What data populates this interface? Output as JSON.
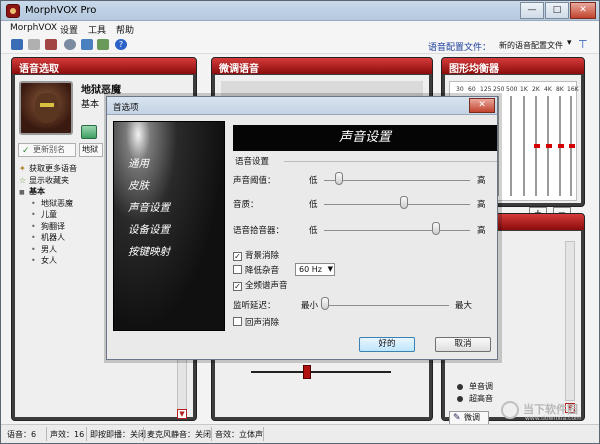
{
  "window": {
    "title": "MorphVOX Pro",
    "min": "—",
    "max": "□",
    "close": "✕"
  },
  "menu": [
    "MorphVOX",
    "设置",
    "工具",
    "帮助"
  ],
  "toolbar": {
    "preset_label": "语音配置文件：",
    "preset_value": "新的语音配置文件"
  },
  "panels": {
    "voice_select": {
      "title": "语音选取",
      "voice_name": "地狱恶魔",
      "voice_category": "基本",
      "update_label": "更新别名",
      "more_label": "地狱",
      "tree": [
        {
          "label": "获取更多语音",
          "level": 0,
          "marker": "✦"
        },
        {
          "label": "显示收藏夹",
          "level": 0,
          "marker": "☆"
        },
        {
          "label": "基本",
          "level": 0,
          "marker": "■"
        },
        {
          "label": "地狱恶魔",
          "level": 1,
          "marker": "•"
        },
        {
          "label": "儿童",
          "level": 1,
          "marker": "•"
        },
        {
          "label": "狗翻译",
          "level": 1,
          "marker": "•"
        },
        {
          "label": "机器人",
          "level": 1,
          "marker": "•"
        },
        {
          "label": "男人",
          "level": 1,
          "marker": "•"
        },
        {
          "label": "女人",
          "level": 1,
          "marker": "•"
        }
      ]
    },
    "tune": {
      "title": "微调语音"
    },
    "equalizer": {
      "title": "图形均衡器",
      "bands": [
        "30",
        "60",
        "125",
        "250",
        "500",
        "1K",
        "2K",
        "4K",
        "8K",
        "16K"
      ],
      "add_label": "+",
      "remove_label": "−"
    },
    "effects": {
      "radios": [
        "单音调",
        "超高音"
      ],
      "tune_button": "微调"
    }
  },
  "status": {
    "voice": "语音：6",
    "effects": "声效：16",
    "push_to_talk": "即按即播：关闭",
    "mute": "麦克风静音：关闭",
    "audio": "音效：立体声"
  },
  "dialog": {
    "title": "首选项",
    "close": "✕",
    "nav": [
      "通用",
      "皮肤",
      "声音设置",
      "设备设置",
      "按键映射"
    ],
    "nav_active": "声音设置",
    "header": "声音设置",
    "group_title": "语音设置",
    "sliders": [
      {
        "label": "声音阈值：",
        "min": "低",
        "max": "高",
        "value": 0.08
      },
      {
        "label": "音质：",
        "min": "低",
        "max": "高",
        "value": 0.55
      },
      {
        "label": "语音拾音器：",
        "min": "低",
        "max": "高",
        "value": 0.78
      }
    ],
    "options": [
      {
        "label": "背景消除",
        "checked": true
      },
      {
        "label": "降低杂音",
        "checked": false
      },
      {
        "label": "全频谱声音",
        "checked": true
      }
    ],
    "noise_freq": "60 Hz",
    "delay": {
      "label": "监听延迟：",
      "min": "最小",
      "max": "最大",
      "value": 0.0
    },
    "echo": {
      "label": "回声消除",
      "checked": false
    },
    "ok_label": "好的",
    "cancel_label": "取消"
  },
  "watermark": {
    "text": "当下软件园",
    "sub": "www.downxia.com"
  },
  "colors": {
    "panel_header": "#b01818",
    "link_blue": "#1b3e9b"
  }
}
